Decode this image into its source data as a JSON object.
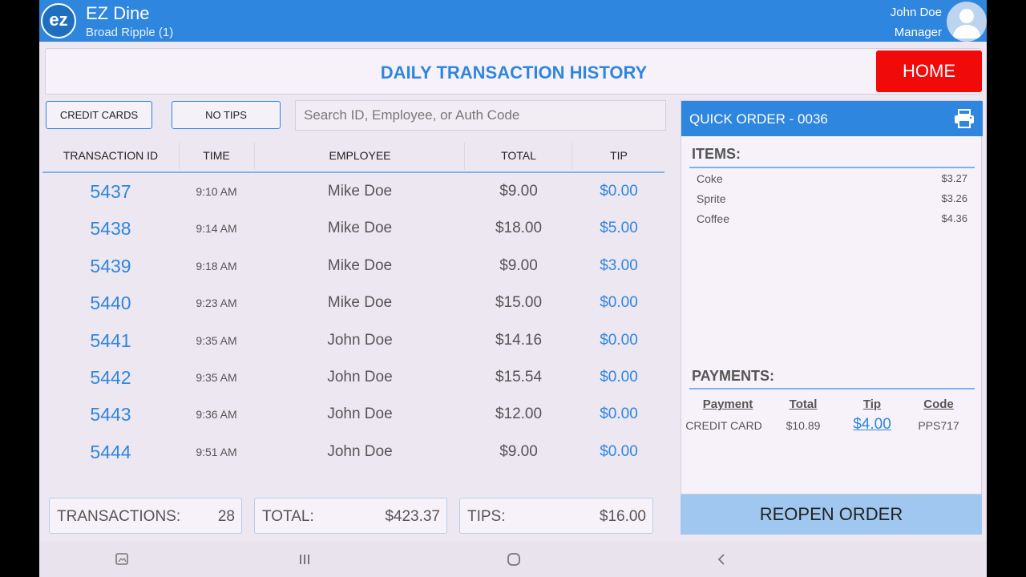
{
  "app": {
    "logo_text": "ez",
    "title": "EZ Dine",
    "location": "Broad Ripple (1)",
    "user_name": "John Doe",
    "user_role": "Manager"
  },
  "header": {
    "title": "DAILY TRANSACTION HISTORY",
    "home_label": "HOME"
  },
  "filters": {
    "credit_cards_label": "CREDIT CARDS",
    "no_tips_label": "NO TIPS",
    "search_placeholder": "Search ID, Employee, or Auth Code"
  },
  "table": {
    "headers": [
      "TRANSACTION ID",
      "TIME",
      "EMPLOYEE",
      "TOTAL",
      "TIP"
    ],
    "rows": [
      {
        "id": "5437",
        "time": "9:10 AM",
        "employee": "Mike Doe",
        "total": "$9.00",
        "tip": "$0.00"
      },
      {
        "id": "5438",
        "time": "9:14 AM",
        "employee": "Mike Doe",
        "total": "$18.00",
        "tip": "$5.00"
      },
      {
        "id": "5439",
        "time": "9:18 AM",
        "employee": "Mike Doe",
        "total": "$9.00",
        "tip": "$3.00"
      },
      {
        "id": "5440",
        "time": "9:23 AM",
        "employee": "Mike Doe",
        "total": "$15.00",
        "tip": "$0.00"
      },
      {
        "id": "5441",
        "time": "9:35 AM",
        "employee": "John Doe",
        "total": "$14.16",
        "tip": "$0.00"
      },
      {
        "id": "5442",
        "time": "9:35 AM",
        "employee": "John Doe",
        "total": "$15.54",
        "tip": "$0.00"
      },
      {
        "id": "5443",
        "time": "9:36 AM",
        "employee": "John Doe",
        "total": "$12.00",
        "tip": "$0.00"
      },
      {
        "id": "5444",
        "time": "9:51 AM",
        "employee": "John Doe",
        "total": "$9.00",
        "tip": "$0.00"
      }
    ]
  },
  "summary": {
    "transactions_label": "TRANSACTIONS:",
    "transactions_value": "28",
    "total_label": "TOTAL:",
    "total_value": "$423.37",
    "tips_label": "TIPS:",
    "tips_value": "$16.00"
  },
  "order": {
    "title": "QUICK ORDER - 0036",
    "items_title": "ITEMS:",
    "items": [
      {
        "name": "Coke",
        "price": "$3.27"
      },
      {
        "name": "Sprite",
        "price": "$3.26"
      },
      {
        "name": "Coffee",
        "price": "$4.36"
      }
    ],
    "payments_title": "PAYMENTS:",
    "payment_headers": [
      "Payment",
      "Total",
      "Tip",
      "Code"
    ],
    "payment": {
      "method": "CREDIT CARD",
      "total": "$10.89",
      "tip": "$4.00",
      "code": "PPS717"
    },
    "reopen_label": "REOPEN ORDER"
  },
  "icons": {
    "printer": "printer-icon",
    "avatar": "user-avatar-icon",
    "nav": [
      "screenshot-icon",
      "recents-icon",
      "home-circle-icon",
      "back-icon"
    ]
  },
  "colors": {
    "primary": "#2f86de",
    "home_red": "#f00a0a",
    "reopen": "#9fc7ef"
  }
}
